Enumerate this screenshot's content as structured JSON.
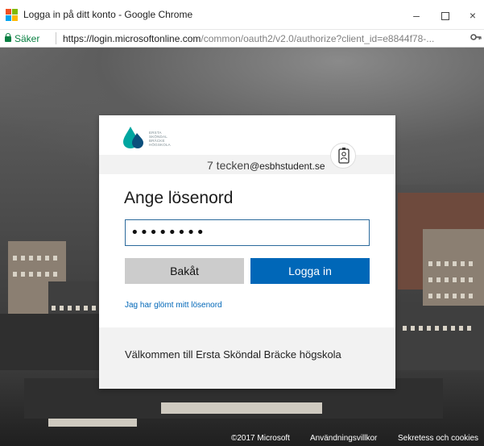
{
  "window": {
    "title": "Logga in på ditt konto - Google Chrome",
    "controls": {
      "minimize": "–",
      "close": "×"
    }
  },
  "addressbar": {
    "secure_label": "Säker",
    "url_host": "https://login.microsoftonline.com",
    "url_path": "/common/oauth2/v2.0/authorize?client_id=e8844f78-...",
    "key_icon": "key-icon"
  },
  "card": {
    "logo_text": [
      "ERSTA",
      "SKÖNDAL",
      "BRÄCKE",
      "HÖGSKOLA"
    ],
    "identity_prefix": "7 tecken",
    "identity_domain": "@esbhstudent.se",
    "heading": "Ange lösenord",
    "password_value": "••••••••",
    "back_label": "Bakåt",
    "signin_label": "Logga in",
    "forgot_label": "Jag har glömt mitt lösenord",
    "welcome_text": "Välkommen till Ersta Sköndal Bräcke högskola"
  },
  "footer": {
    "copyright": "©2017 Microsoft",
    "terms": "Användningsvillkor",
    "privacy": "Sekretess och cookies"
  },
  "colors": {
    "accent": "#0067b8",
    "secure_green": "#0a8043",
    "back_button": "#cccccc",
    "panel_gray": "#f2f2f2"
  }
}
